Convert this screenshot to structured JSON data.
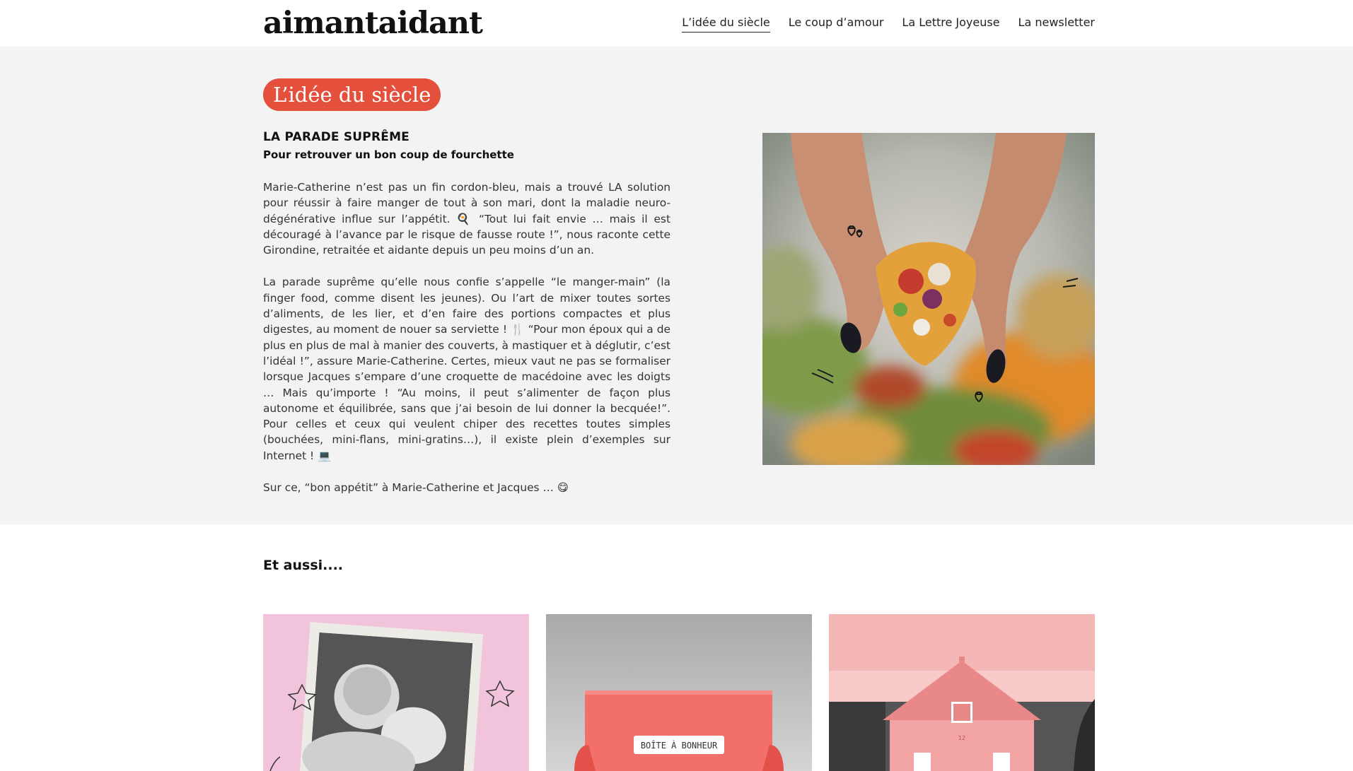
{
  "brand": {
    "logo_text": "aimantaidant"
  },
  "nav": {
    "items": [
      {
        "label": "L’idée du siècle",
        "active": true
      },
      {
        "label": "Le coup d’amour",
        "active": false
      },
      {
        "label": "La Lettre Joyeuse",
        "active": false
      },
      {
        "label": "La newsletter",
        "active": false
      }
    ]
  },
  "hero": {
    "badge": "L’idée du siècle",
    "kicker": "LA PARADE SUPRÊME",
    "subtitle": "Pour retrouver un bon coup de fourchette",
    "paragraphs": [
      "Marie-Catherine n’est pas un fin cordon-bleu, mais a trouvé LA solution pour réussir à faire manger de tout à son mari, dont la maladie neuro-dégénérative influe sur l’appétit. 🍳 “Tout lui fait envie … mais il est découragé à l’avance par le risque de fausse route !”, nous raconte cette Girondine, retraitée et aidante depuis un peu moins d’un an.",
      "La parade suprême qu’elle nous confie s’appelle “le manger-main” (la finger food, comme disent les jeunes). Ou l’art de mixer toutes sortes d’aliments, de les lier, et d’en faire des portions compactes et plus digestes, au moment de nouer sa serviette ! 🍴 “Pour mon époux qui a de plus en plus de mal à manier des couverts, à mastiquer et à déglutir, c’est l’idéal !”, assure Marie-Catherine. Certes, mieux vaut ne pas se formaliser lorsque Jacques s’empare d’une croquette de macédoine avec les doigts … Mais qu’importe ! “Au moins, il peut s’alimenter de façon plus autonome et équilibrée, sans que j’ai besoin de lui donner la becquée!”. Pour celles et ceux qui veulent chiper des recettes toutes simples (bouchées, mini-flans, mini-gratins…), il existe plein d’exemples sur Internet ! 💻",
      "Sur ce, “bon appétit” à Marie-Catherine et Jacques … 😋"
    ]
  },
  "more": {
    "title": "Et aussi....",
    "cards": [
      {
        "icon": "elderly-woman-with-dog-photo"
      },
      {
        "icon": "box-of-happiness-photo",
        "box_label": "BOÎTE À BONHEUR"
      },
      {
        "icon": "pink-house-photo",
        "house_sign": "12"
      }
    ]
  },
  "colors": {
    "accent": "#e4503c",
    "hero_bg": "#f3f3f3"
  }
}
